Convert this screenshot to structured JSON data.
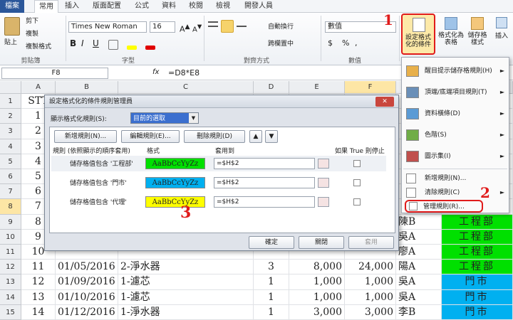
{
  "tabs": [
    "檔案",
    "常用",
    "插入",
    "版面配置",
    "公式",
    "資料",
    "校閱",
    "檢視",
    "開發人員"
  ],
  "ribbon": {
    "paste": "貼上",
    "cut": "剪下",
    "copy": "複製",
    "format_painter": "複製格式",
    "clipboard": "剪貼簿",
    "font_name": "Times New Roman",
    "font_size": "16",
    "bold": "B",
    "italic": "I",
    "underline": "U",
    "font_group": "字型",
    "wrap_text": "自動換行",
    "merge_center": "跨欄置中",
    "alignment_group": "對齊方式",
    "number_format": "數值",
    "percent": "%",
    "comma": ",",
    "currency": "$",
    "number_group": "數值",
    "cond_format": "設定格式化的條件",
    "format_table": "格式化為表格",
    "cell_styles": "儲存格樣式",
    "insert": "插入"
  },
  "formula_bar": {
    "name_box": "F8",
    "fx": "fx",
    "formula": "=D8*E8"
  },
  "columns": [
    "A",
    "B",
    "C",
    "D",
    "E",
    "F",
    "G",
    "H"
  ],
  "rows": [
    {
      "n": "1",
      "a": "STT",
      "b": "",
      "c": "",
      "d": "",
      "e": "",
      "f": "",
      "g": "",
      "h": "倨"
    },
    {
      "n": "2",
      "a": "1",
      "b": "",
      "c": "",
      "d": "",
      "e": "",
      "f": "",
      "g": "",
      "h": ""
    },
    {
      "n": "3",
      "a": "2",
      "b": "",
      "c": "",
      "d": "",
      "e": "",
      "f": "",
      "g": "",
      "h": ""
    },
    {
      "n": "4",
      "a": "3",
      "b": "",
      "c": "",
      "d": "",
      "e": "",
      "f": "",
      "g": "",
      "h": ""
    },
    {
      "n": "5",
      "a": "4",
      "b": "",
      "c": "",
      "d": "",
      "e": "",
      "f": "",
      "g": "",
      "h": ""
    },
    {
      "n": "6",
      "a": "5",
      "b": "",
      "c": "",
      "d": "",
      "e": "",
      "f": "",
      "g": "",
      "h": ""
    },
    {
      "n": "7",
      "a": "6",
      "b": "",
      "c": "",
      "d": "",
      "e": "",
      "f": "",
      "g": "",
      "h": ""
    },
    {
      "n": "8",
      "a": "7",
      "b": "",
      "c": "",
      "d": "",
      "e": "",
      "f": "",
      "g": "",
      "h": ""
    },
    {
      "n": "9",
      "a": "8",
      "b": "",
      "c": "",
      "d": "",
      "e": "",
      "f": "",
      "g": "陳B",
      "h": "工程部"
    },
    {
      "n": "10",
      "a": "9",
      "b": "",
      "c": "",
      "d": "",
      "e": "",
      "f": "",
      "g": "吳A",
      "h": "工程部"
    },
    {
      "n": "11",
      "a": "10",
      "b": "",
      "c": "",
      "d": "",
      "e": "",
      "f": "",
      "g": "廖A",
      "h": "工程部"
    },
    {
      "n": "12",
      "a": "11",
      "b": "01/05/2016",
      "c": "2-淨水器",
      "d": "3",
      "e": "8,000",
      "f": "24,000",
      "g": "陽A",
      "h": "工程部"
    },
    {
      "n": "13",
      "a": "12",
      "b": "01/09/2016",
      "c": "1-濾芯",
      "d": "1",
      "e": "1,000",
      "f": "1,000",
      "g": "吳A",
      "h": "門市"
    },
    {
      "n": "14",
      "a": "13",
      "b": "01/10/2016",
      "c": "1-濾芯",
      "d": "1",
      "e": "1,000",
      "f": "1,000",
      "g": "吳A",
      "h": "門市"
    },
    {
      "n": "15",
      "a": "14",
      "b": "01/12/2016",
      "c": "1-淨水器",
      "d": "1",
      "e": "3,000",
      "f": "3,000",
      "g": "李B",
      "h": "門市"
    }
  ],
  "dialog": {
    "title": "設定格式化的條件規則管理員",
    "show_rules_label": "顯示格式化規則(S):",
    "show_rules_value": "目前的選取",
    "new_rule": "新增規則(N)...",
    "edit_rule": "編輯規則(E)...",
    "delete_rule": "刪除規則(D)",
    "col_rule": "規則 (依照顯示的順序套用)",
    "col_format": "格式",
    "col_applies": "套用到",
    "col_stop": "如果 True 則停止",
    "rules": [
      {
        "name": "儲存格值包含 '工程部'",
        "preview": "AaBbCcYyZz",
        "color": "#00e000",
        "applies": "=$H$2"
      },
      {
        "name": "儲存格值包含 '門市'",
        "preview": "AaBbCcYyZz",
        "color": "#00b0f0",
        "applies": "=$H$2"
      },
      {
        "name": "儲存格值包含 '代理'",
        "preview": "AaBbCcYyZz",
        "color": "#ffff00",
        "applies": "=$H$2"
      }
    ],
    "ok": "確定",
    "close": "關閉",
    "apply": "套用"
  },
  "menu": {
    "items": [
      {
        "label": "醒目提示儲存格規則(H)",
        "arrow": "►"
      },
      {
        "label": "頂端/底端項目規則(T)",
        "arrow": "►"
      },
      {
        "label": "資料橫條(D)",
        "arrow": "►"
      },
      {
        "label": "色階(S)",
        "arrow": "►"
      },
      {
        "label": "圖示集(I)",
        "arrow": "►"
      }
    ],
    "new_rule": "新增規則(N)...",
    "clear_rules": "清除規則(C)",
    "manage_rules": "管理規則(R)..."
  },
  "callouts": {
    "one": "1",
    "two": "2",
    "three": "3"
  },
  "colors": {
    "green": "#00e000",
    "blue": "#00b0f0",
    "yellow": "#ffff00",
    "accent": "#e01b1b",
    "file_tab": "#2b579a"
  }
}
